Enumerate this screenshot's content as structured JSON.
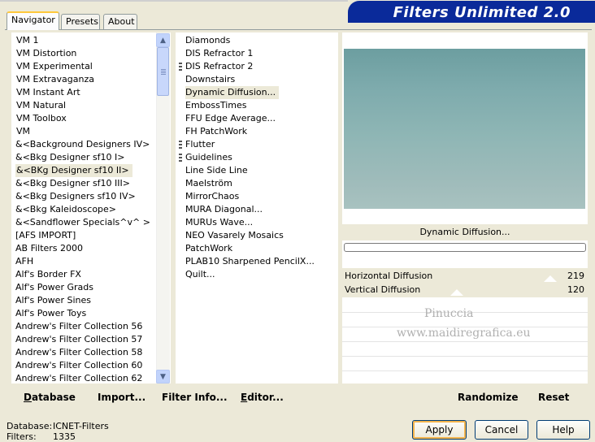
{
  "tabs": [
    "Navigator",
    "Presets",
    "About"
  ],
  "title": "Filters Unlimited 2.0",
  "categories": [
    "VM 1",
    "VM Distortion",
    "VM Experimental",
    "VM Extravaganza",
    "VM Instant Art",
    "VM Natural",
    "VM Toolbox",
    "VM",
    "&<Background Designers IV>",
    "&<Bkg Designer sf10 I>",
    "&<BKg Designer sf10 II>",
    "&<Bkg Designer sf10 III>",
    "&<Bkg Designers sf10 IV>",
    "&<Bkg Kaleidoscope>",
    "&<Sandflower Specials^v^ >",
    "[AFS IMPORT]",
    "AB Filters 2000",
    "AFH",
    "Alf's Border FX",
    "Alf's Power Grads",
    "Alf's Power Sines",
    "Alf's Power Toys",
    "Andrew's Filter Collection 56",
    "Andrew's Filter Collection 57",
    "Andrew's Filter Collection 58",
    "Andrew's Filter Collection 60",
    "Andrew's Filter Collection 62"
  ],
  "selected_category": "&<BKg Designer sf10 II>",
  "filters": [
    "Diamonds",
    "DIS Refractor 1",
    "DIS Refractor 2",
    "Downstairs",
    "Dynamic Diffusion...",
    "EmbossTimes",
    "FFU Edge Average...",
    "FH PatchWork",
    "Flutter",
    "Guidelines",
    "Line Side Line",
    "Maelström",
    "MirrorChaos",
    "MURA Diagonal...",
    "MURUs Wave...",
    "NEO Vasarely Mosaics",
    "PatchWork",
    "PLAB10 Sharpened PencilX...",
    "Quilt..."
  ],
  "selected_filter": "Dynamic Diffusion...",
  "current_filter_name": "Dynamic Diffusion...",
  "progress_fraction": 0,
  "params": [
    {
      "label": "Horizontal Diffusion",
      "value": "219"
    },
    {
      "label": "Vertical Diffusion",
      "value": "120"
    }
  ],
  "watermark": {
    "line1": "Pinuccia",
    "line2": "www.maidiregrafica.eu"
  },
  "left_toolbar": [
    "Database",
    "Import...",
    "Filter Info...",
    "Editor..."
  ],
  "right_toolbar": [
    "Randomize",
    "Reset"
  ],
  "status": {
    "database_label": "Database:",
    "database_value": "ICNET-Filters",
    "filters_label": "Filters:",
    "filters_value": "1335"
  },
  "buttons": {
    "apply": "Apply",
    "cancel": "Cancel",
    "help": "Help"
  },
  "colors": {
    "banner": "#0a2a9a",
    "preview_top": "#6c9ea0",
    "preview_bottom": "#a8c2c0"
  }
}
